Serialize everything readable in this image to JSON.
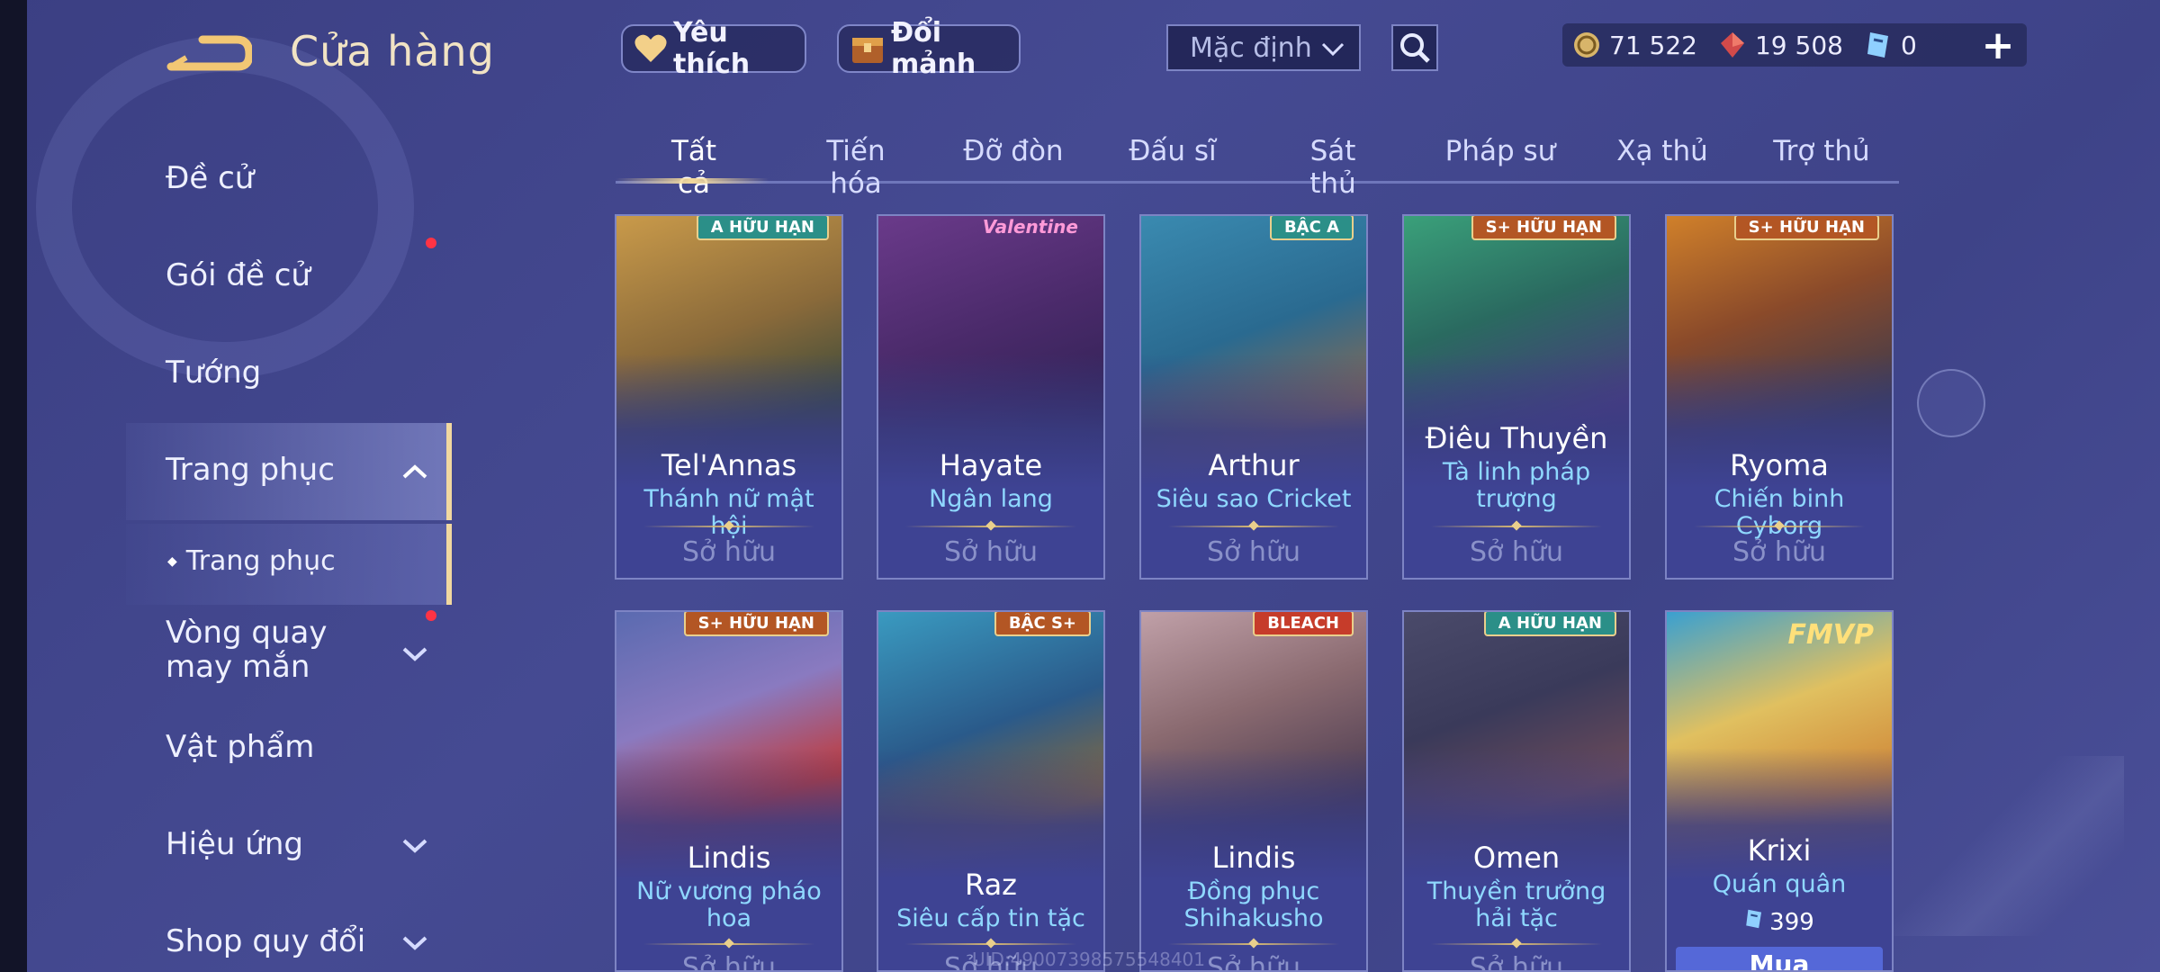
{
  "header": {
    "title": "Cửa hàng",
    "favorites_label": "Yêu thích",
    "fragments_label": "Đổi mảnh",
    "sort_value": "Mặc định"
  },
  "currency": {
    "gold": "71 522",
    "gems": "19 508",
    "vouchers": "0"
  },
  "sidebar": {
    "items": [
      {
        "label": "Đề cử"
      },
      {
        "label": "Gói đề cử"
      },
      {
        "label": "Tướng"
      },
      {
        "label": "Trang phục"
      },
      {
        "label": "Vòng quay may mắn"
      },
      {
        "label": "Vật phẩm"
      },
      {
        "label": "Hiệu ứng"
      },
      {
        "label": "Shop quy đổi"
      }
    ],
    "sub_item": "Trang phục"
  },
  "tabs": [
    "Tất cả",
    "Tiến hóa",
    "Đỡ đòn",
    "Đấu sĩ",
    "Sát thủ",
    "Pháp sư",
    "Xạ thủ",
    "Trợ thủ"
  ],
  "cards": [
    {
      "hero": "Tel'Annas",
      "skin": "Thánh nữ mật hội",
      "status": "Sở hữu",
      "badge": "A HỮU HẠN"
    },
    {
      "hero": "Hayate",
      "skin": "Ngân lang",
      "status": "Sở hữu",
      "badge": "Valentine"
    },
    {
      "hero": "Arthur",
      "skin": "Siêu sao Cricket",
      "status": "Sở hữu",
      "badge": "BẬC A"
    },
    {
      "hero": "Điêu Thuyền",
      "skin": "Tà linh pháp trượng",
      "status": "Sở hữu",
      "badge": "S+ HỮU HẠN"
    },
    {
      "hero": "Ryoma",
      "skin": "Chiến binh Cyborg",
      "status": "Sở hữu",
      "badge": "S+ HỮU HẠN"
    },
    {
      "hero": "Lindis",
      "skin": "Nữ vương pháo hoa",
      "status": "Sở hữu",
      "badge": "S+ HỮU HẠN"
    },
    {
      "hero": "Raz",
      "skin": "Siêu cấp tin tặc",
      "status": "Sở hữu",
      "badge": "BẬC S+"
    },
    {
      "hero": "Lindis",
      "skin": "Đồng phục Shihakusho",
      "status": "Sở hữu",
      "badge": "BLEACH"
    },
    {
      "hero": "Omen",
      "skin": "Thuyền trưởng hải tặc",
      "status": "Sở hữu",
      "badge": "A HỮU HẠN"
    },
    {
      "hero": "Krixi",
      "skin": "Quán quân",
      "price": "399",
      "buy_label": "Mua",
      "badge": "FMVP"
    }
  ],
  "watermark": "UID:49007398575548401",
  "colors": {
    "background": "#40458c",
    "accent_gold": "#f1d8a0",
    "skin_text": "#8fd8ff",
    "owned_text": "#8a91c9",
    "buy_button": "#5568d8",
    "notify_dot": "#ff3344"
  }
}
